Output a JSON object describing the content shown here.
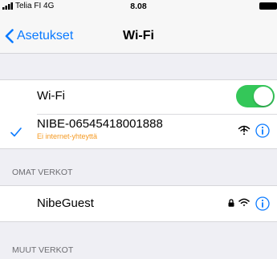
{
  "status_bar": {
    "carrier": "Telia FI",
    "network": "4G",
    "time": "8.08"
  },
  "nav": {
    "back_label": "Asetukset",
    "title": "Wi-Fi"
  },
  "wifi_toggle": {
    "label": "Wi-Fi",
    "on": true
  },
  "connected_network": {
    "name": "NIBE-06545418001888",
    "status": "Ei internet-yhteyttä"
  },
  "own_networks": {
    "header": "OMAT VERKOT",
    "items": [
      {
        "name": "NibeGuest"
      }
    ]
  },
  "other_networks": {
    "header": "MUUT VERKOT"
  },
  "colors": {
    "accent": "#0a7aff",
    "toggle_on": "#34c759",
    "warning_text": "#f59a23",
    "background": "#efeff4"
  },
  "icons": {
    "signal": "signal-bars-icon",
    "battery": "battery-icon",
    "back": "chevron-left-icon",
    "check": "checkmark-icon",
    "warning_wifi": "wifi-warning-icon",
    "info": "info-circle-icon",
    "lock": "lock-icon",
    "wifi": "wifi-icon"
  }
}
